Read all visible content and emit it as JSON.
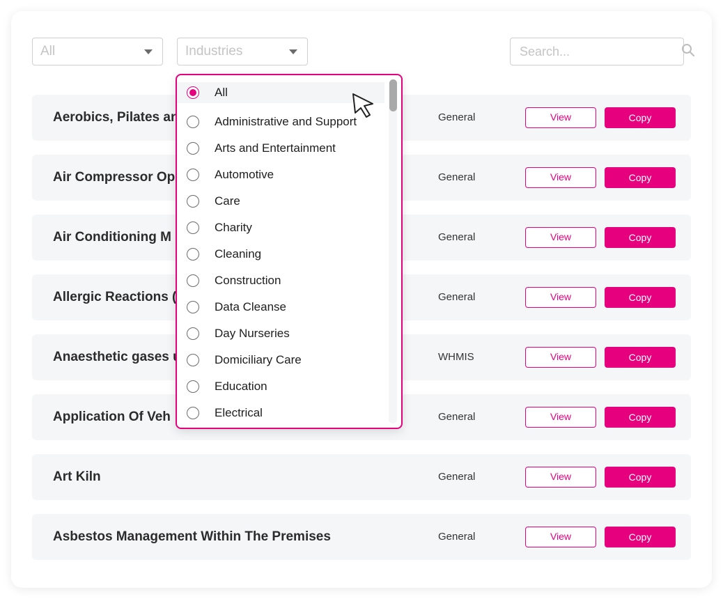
{
  "filters": {
    "type_select": {
      "value": "All"
    },
    "industry_select": {
      "value": "Industries"
    },
    "search": {
      "placeholder": "Search..."
    }
  },
  "industry_dropdown": {
    "selected": "All",
    "options": [
      "All",
      "Administrative and Support",
      "Arts and Entertainment",
      "Automotive",
      "Care",
      "Charity",
      "Cleaning",
      "Construction",
      "Data Cleanse",
      "Day Nurseries",
      "Domiciliary Care",
      "Education",
      "Electrical"
    ],
    "scroll_position": 0.0
  },
  "rows": [
    {
      "title": "Aerobics, Pilates an",
      "category": "General",
      "view_label": "View",
      "copy_label": "Copy"
    },
    {
      "title": "Air Compressor Op",
      "category": "General",
      "view_label": "View",
      "copy_label": "Copy"
    },
    {
      "title": "Air Conditioning M",
      "category": "General",
      "view_label": "View",
      "copy_label": "Copy"
    },
    {
      "title": "Allergic Reactions (",
      "category": "General",
      "view_label": "View",
      "copy_label": "Copy"
    },
    {
      "title": "Anaesthetic gases u",
      "category": "WHMIS",
      "view_label": "View",
      "copy_label": "Copy"
    },
    {
      "title": "Application Of Veh",
      "category": "General",
      "view_label": "View",
      "copy_label": "Copy"
    },
    {
      "title": "Art Kiln",
      "category": "General",
      "view_label": "View",
      "copy_label": "Copy"
    },
    {
      "title": "Asbestos Management Within The Premises",
      "category": "General",
      "view_label": "View",
      "copy_label": "Copy"
    }
  ],
  "colors": {
    "accent": "#e6007e",
    "row_background": "#f5f6f8"
  }
}
